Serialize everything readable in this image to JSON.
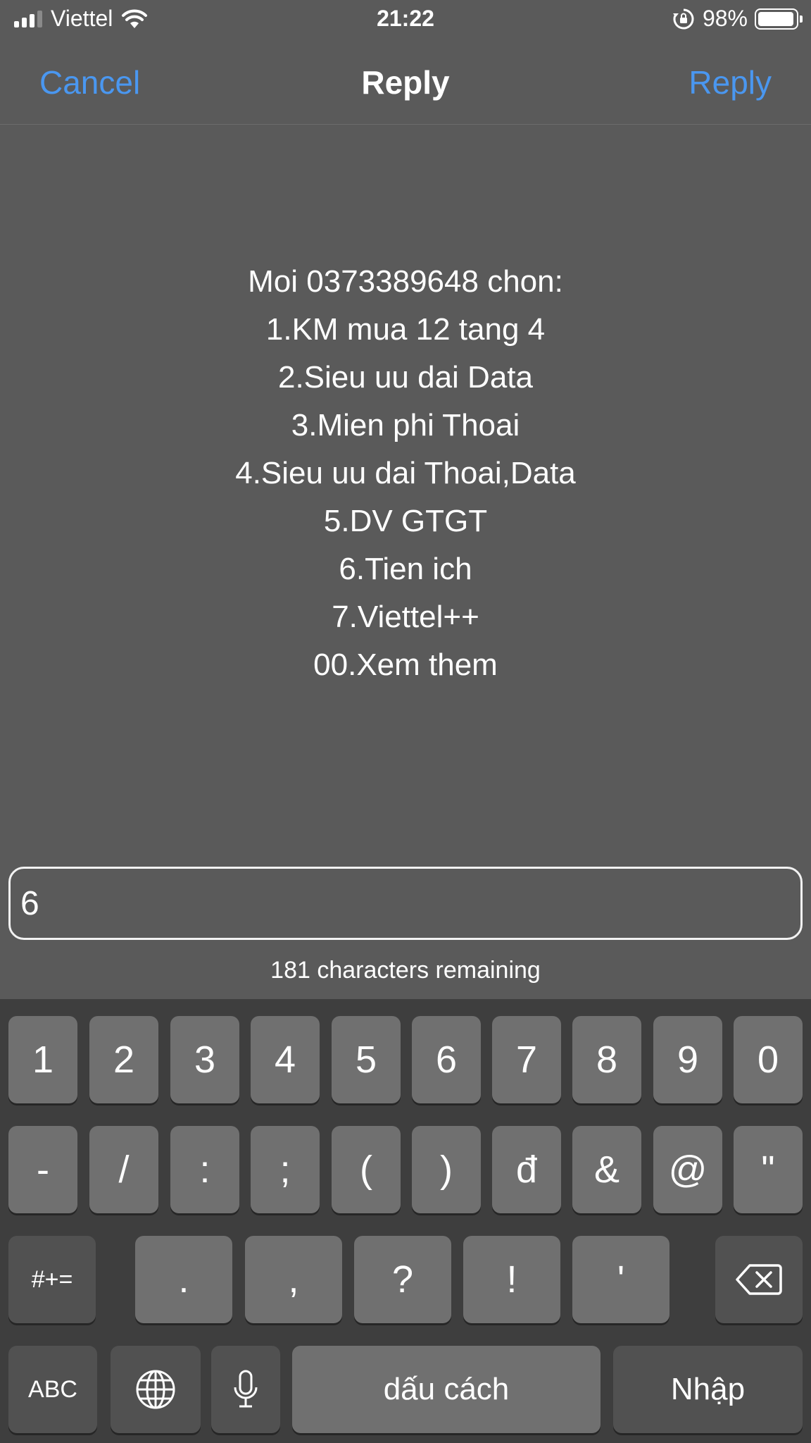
{
  "status_bar": {
    "carrier": "Viettel",
    "time": "21:22",
    "battery_percent": "98%",
    "signal_bars": 3,
    "icons": [
      "signal-icon",
      "wifi-icon",
      "rotation-lock-icon",
      "battery-icon"
    ]
  },
  "nav": {
    "cancel_label": "Cancel",
    "title": "Reply",
    "reply_label": "Reply"
  },
  "message": {
    "lines": [
      "Moi 0373389648 chon:",
      "1.KM mua 12 tang 4",
      "2.Sieu uu dai Data",
      "3.Mien phi Thoai",
      "4.Sieu uu dai Thoai,Data",
      "5.DV GTGT",
      "6.Tien ich",
      "7.Viettel++",
      "00.Xem them"
    ]
  },
  "input": {
    "value": "6",
    "remaining_text": "181 characters remaining"
  },
  "keyboard": {
    "row1": [
      "1",
      "2",
      "3",
      "4",
      "5",
      "6",
      "7",
      "8",
      "9",
      "0"
    ],
    "row2": [
      "-",
      "/",
      ":",
      ";",
      "(",
      ")",
      "đ",
      "&",
      "@",
      "\""
    ],
    "row3": {
      "shift_label": "#+=",
      "keys": [
        ".",
        ",",
        "?",
        "!",
        "'"
      ],
      "delete_icon": "backspace-icon"
    },
    "row4": {
      "abc_label": "ABC",
      "globe_icon": "globe-icon",
      "mic_icon": "microphone-icon",
      "space_label": "dấu cách",
      "return_label": "Nhập"
    }
  },
  "colors": {
    "background": "#5a5a5a",
    "accent": "#4a97f0",
    "keyboard_bg": "#3e3e3e",
    "key": "#707070",
    "key_dark": "#515151"
  }
}
